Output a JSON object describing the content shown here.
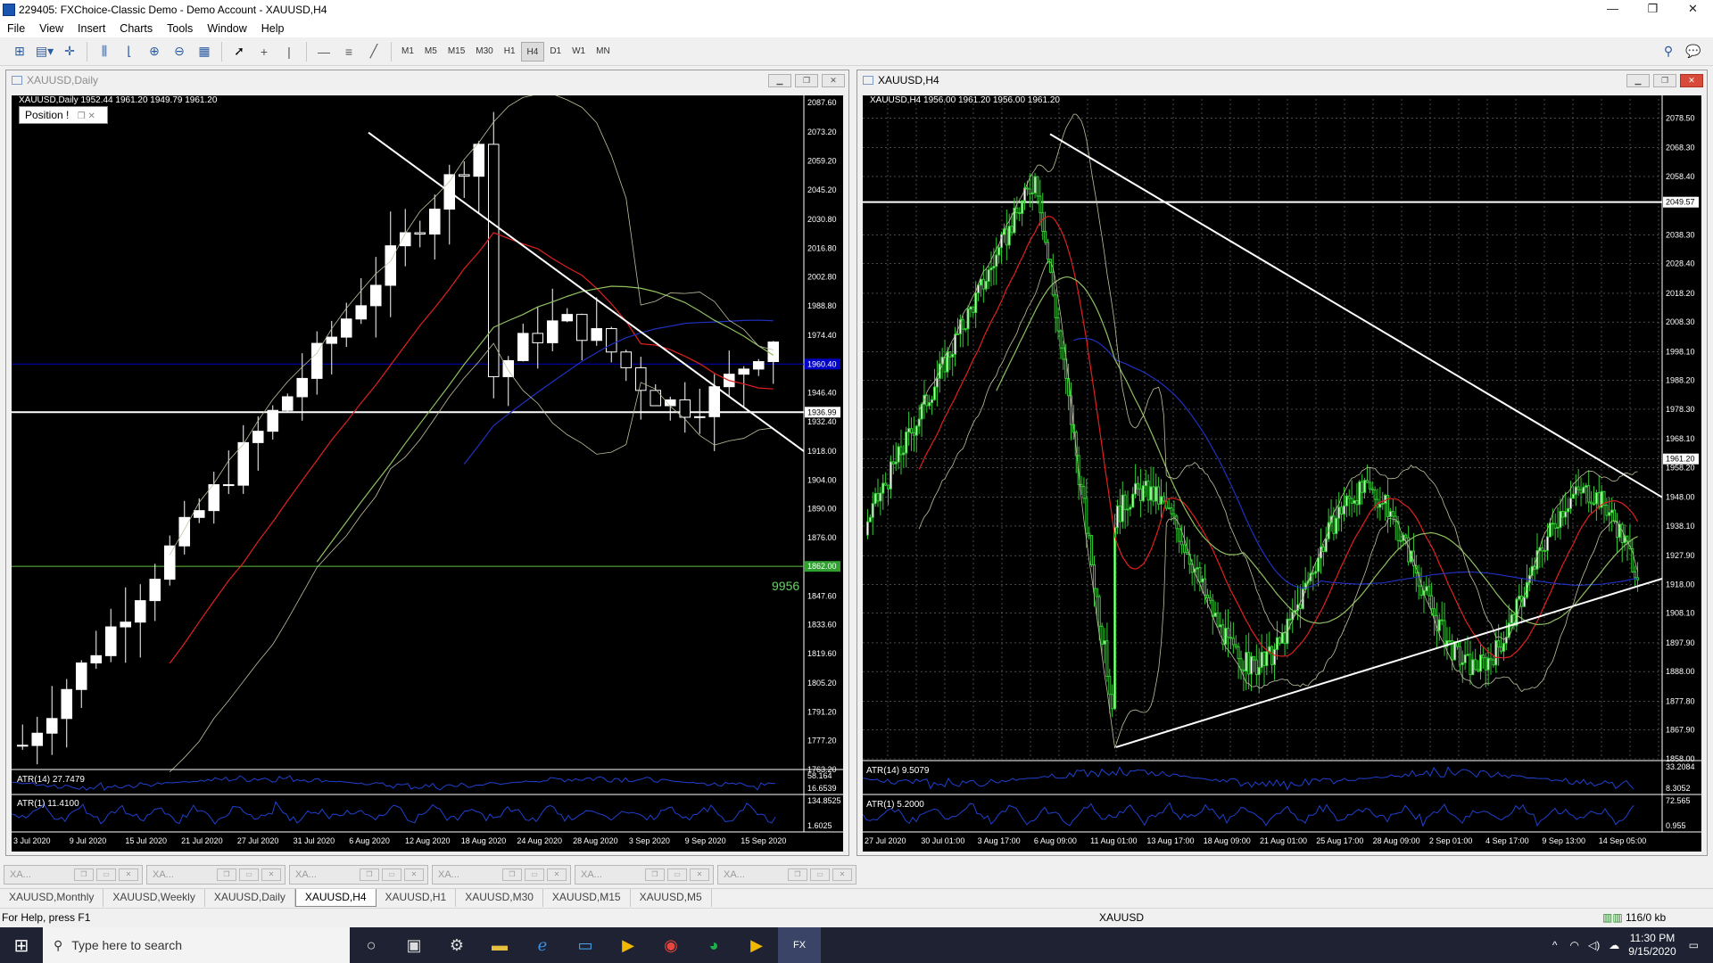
{
  "window": {
    "title": "229405: FXChoice-Classic Demo - Demo Account - XAUUSD,H4",
    "buttons": [
      "—",
      "❐",
      "✕"
    ]
  },
  "menu": [
    "File",
    "View",
    "Insert",
    "Charts",
    "Tools",
    "Window",
    "Help"
  ],
  "toolbar": {
    "timeframes": [
      "M1",
      "M5",
      "M15",
      "M30",
      "H1",
      "H4",
      "D1",
      "W1",
      "MN"
    ],
    "active_timeframe": "H4",
    "icons": [
      "new-chart-icon",
      "profiles-icon",
      "crosshair-icon",
      "bar-chart-icon",
      "line-chart-icon",
      "zoom-in-icon",
      "zoom-out-icon",
      "tile-windows-icon",
      "cursor-icon",
      "crosshair-tool-icon",
      "vertical-line-icon",
      "horizontal-line-icon",
      "fibonacci-icon",
      "trendline-icon",
      "search-icon",
      "chat-icon"
    ]
  },
  "left_chart": {
    "window_title": "XAUUSD,Daily",
    "info_line": "XAUUSD,Daily  1952.44 1961.20 1949.79 1961.20",
    "position_label": "Position !",
    "price_labels": [
      "2087.60",
      "2073.20",
      "2059.20",
      "2045.20",
      "2030.80",
      "2016.80",
      "2002.80",
      "1988.80",
      "1974.40",
      "1960.40",
      "1946.40",
      "1936.99",
      "1932.40",
      "1918.00",
      "1904.00",
      "1890.00",
      "1876.00",
      "1862.00",
      "1847.60",
      "1833.60",
      "1819.60",
      "1805.20",
      "1791.20",
      "1777.20",
      "1763.20"
    ],
    "current_price": "1960.40",
    "hline_white": "1936.99",
    "hline_green": "1862.00",
    "green_label": "9956",
    "date_labels": [
      "3 Jul 2020",
      "9 Jul 2020",
      "15 Jul 2020",
      "21 Jul 2020",
      "27 Jul 2020",
      "31 Jul 2020",
      "6 Aug 2020",
      "12 Aug 2020",
      "18 Aug 2020",
      "24 Aug 2020",
      "28 Aug 2020",
      "3 Sep 2020",
      "9 Sep 2020",
      "15 Sep 2020"
    ],
    "atr14_label": "ATR(14) 27.7479",
    "atr14_scale": [
      "58.164",
      "16.6539"
    ],
    "atr1_label": "ATR(1) 11.4100",
    "atr1_scale": [
      "134.8525",
      "1.6025"
    ]
  },
  "right_chart": {
    "window_title": "XAUUSD,H4",
    "info_line": "XAUUSD,H4  1956.00 1961.20 1956.00 1961.20",
    "price_labels": [
      "2078.50",
      "2068.30",
      "2058.40",
      "2049.57",
      "2038.30",
      "2028.40",
      "2018.20",
      "2008.30",
      "1998.10",
      "1988.20",
      "1978.30",
      "1968.10",
      "1961.20",
      "1958.20",
      "1948.00",
      "1938.10",
      "1927.90",
      "1918.00",
      "1908.10",
      "1897.90",
      "1888.00",
      "1877.80",
      "1867.90",
      "1858.00"
    ],
    "hline_white": "2049.57",
    "current_price": "1961.20",
    "date_labels": [
      "27 Jul 2020",
      "30 Jul 01:00",
      "3 Aug 17:00",
      "6 Aug 09:00",
      "11 Aug 01:00",
      "13 Aug 17:00",
      "18 Aug 09:00",
      "21 Aug 01:00",
      "25 Aug 17:00",
      "28 Aug 09:00",
      "2 Sep 01:00",
      "4 Sep 17:00",
      "9 Sep 13:00",
      "14 Sep 05:00"
    ],
    "atr14_label": "ATR(14) 9.5079",
    "atr14_scale": [
      "33.2084",
      "8.3052"
    ],
    "atr1_label": "ATR(1) 5.2000",
    "atr1_scale": [
      "72.565",
      "0.955"
    ]
  },
  "mini_tabs": [
    "XA...",
    "XA...",
    "XA...",
    "XA...",
    "XA...",
    "XA..."
  ],
  "symbol_tabs": [
    "XAUUSD,Monthly",
    "XAUUSD,Weekly",
    "XAUUSD,Daily",
    "XAUUSD,H4",
    "XAUUSD,H1",
    "XAUUSD,M30",
    "XAUUSD,M15",
    "XAUUSD,M5"
  ],
  "active_symbol_tab": "XAUUSD,H4",
  "status": {
    "help": "For Help, press F1",
    "symbol": "XAUUSD",
    "traffic": "116/0 kb"
  },
  "taskbar": {
    "search_placeholder": "Type here to search",
    "time": "11:30 PM",
    "date": "9/15/2020"
  },
  "colors": {
    "bull_candle": "#ffffff",
    "h4_candle": "#33cc33",
    "bollinger": "#c0c0a0",
    "ma_red": "#e02020",
    "ma_blue": "#2030c0",
    "ma_green": "#90c060",
    "trendline": "#ffffff",
    "price_line": "#0000c8"
  }
}
